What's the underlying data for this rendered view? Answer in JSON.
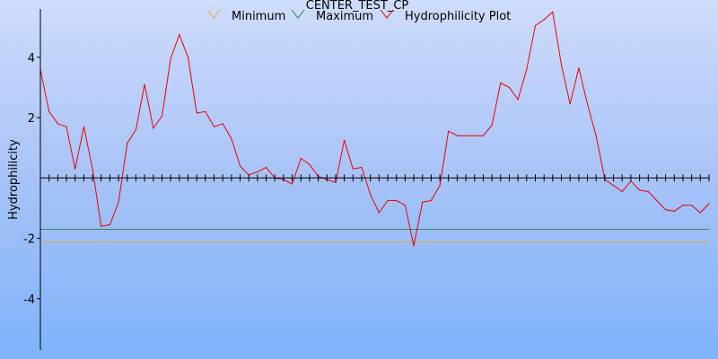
{
  "chart_data": {
    "type": "line",
    "title": "CENTER_TEST_CP",
    "ylabel": "Hydrophilicity",
    "xlabel": "",
    "ylim": [
      -5.7,
      5.6
    ],
    "yticks": [
      -4,
      -2,
      2,
      4
    ],
    "legend_position": "top",
    "grid": false,
    "series": [
      {
        "name": "Minimum",
        "color": "#e9a94a",
        "values": [
          -2.12,
          -2.12
        ]
      },
      {
        "name": "Maximum",
        "color": "#2f8a4a",
        "values": [
          -1.7,
          -1.7
        ]
      },
      {
        "name": "Hydrophilicity Plot",
        "color": "#e8000d",
        "values": [
          3.6,
          2.2,
          1.8,
          1.7,
          0.3,
          1.7,
          0.3,
          -1.6,
          -1.55,
          -0.8,
          1.15,
          1.6,
          3.1,
          1.65,
          2.05,
          3.95,
          4.75,
          4.0,
          2.15,
          2.2,
          1.7,
          1.8,
          1.3,
          0.4,
          0.1,
          0.2,
          0.35,
          0.0,
          -0.05,
          -0.2,
          0.65,
          0.45,
          0.05,
          -0.05,
          -0.15,
          1.25,
          0.3,
          0.35,
          -0.55,
          -1.15,
          -0.75,
          -0.75,
          -0.9,
          -2.25,
          -0.8,
          -0.75,
          -0.25,
          1.55,
          1.4,
          1.4,
          1.4,
          1.4,
          1.75,
          3.15,
          3.0,
          2.6,
          3.6,
          5.05,
          5.25,
          5.5,
          3.75,
          2.45,
          3.65,
          2.45,
          1.4,
          -0.05,
          -0.25,
          -0.45,
          -0.1,
          -0.4,
          -0.45,
          -0.75,
          -1.05,
          -1.1,
          -0.9,
          -0.9,
          -1.15,
          -0.85
        ]
      }
    ]
  }
}
